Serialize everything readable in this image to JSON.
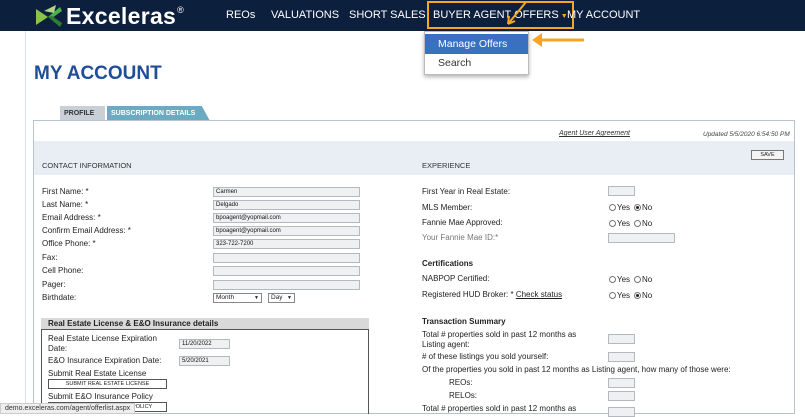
{
  "brand": {
    "name": "Exceleras",
    "reg": "®"
  },
  "nav": [
    "REOs",
    "VALUATIONS",
    "SHORT SALES",
    "BUYER AGENT OFFERS",
    "MY ACCOUNT"
  ],
  "dropdown": [
    "Manage Offers",
    "Search"
  ],
  "page_title": "MY ACCOUNT",
  "tabs": [
    "PROFILE",
    "SUBSCRIPTION DETAILS"
  ],
  "agreement_link": "Agent User Agreement",
  "updated": "Updated 5/5/2020 6:54:50 PM",
  "save_label": "SAVE",
  "contact": {
    "title": "CONTACT INFORMATION",
    "labels": [
      "First Name: *",
      "Last Name: *",
      "Email Address: *",
      "Confirm Email Address: *",
      "Office Phone: *",
      "Fax:",
      "Cell Phone:",
      "Pager:",
      "Birthdate:"
    ],
    "values": [
      "Carmen",
      "Delgado",
      "bpoagent@yopmail.com",
      "bpoagent@yopmail.com",
      "323-722-7200",
      "",
      "",
      ""
    ],
    "month": "Month",
    "day": "Day"
  },
  "license": {
    "title": "Real Estate License & E&O Insurance details",
    "exp_label_1": "Real Estate License Expiration",
    "exp_label_2": "Date:",
    "exp_value": "11/20/2022",
    "eo_label": "E&O Insurance Expiration Date:",
    "eo_value": "5/20/2021",
    "submit_license": "Submit Real Estate License",
    "submit_license_btn": "SUBMIT REAL ESTATE LICENSE",
    "submit_eo": "Submit E&O Insurance Policy",
    "submit_eo_btn": "SUBMIT E&O INSURANCE POLICY"
  },
  "experience": {
    "title": "EXPERIENCE",
    "first_year": "First Year in Real Estate:",
    "mls": "MLS Member:",
    "fannie": "Fannie Mae Approved:",
    "fannie_id": "Your Fannie Mae ID:*",
    "yes": "Yes",
    "no": "No",
    "cert_title": "Certifications",
    "nabpop": "NABPOP Certified:",
    "hud": "Registered HUD Broker: *",
    "check_status": "Check status",
    "tx_title": "Transaction Summary",
    "tx1a": "Total # properties sold in past 12 months as",
    "tx1b": "Listing agent:",
    "tx2": "# of these listings you sold yourself:",
    "tx3": "Of the properties you sold in past 12 months as Listing agent, how many of those were:",
    "reos": "REOs:",
    "relos": "RELOs:",
    "tx4": "Total # properties sold in past 12 months as"
  },
  "status_url": "demo.exceleras.com/agent/offerlist.aspx",
  "colors": {
    "nav_bg": "#0c1f3d",
    "accent": "#f5a623",
    "title": "#1f4e98",
    "highlight": "#3a70c0"
  }
}
